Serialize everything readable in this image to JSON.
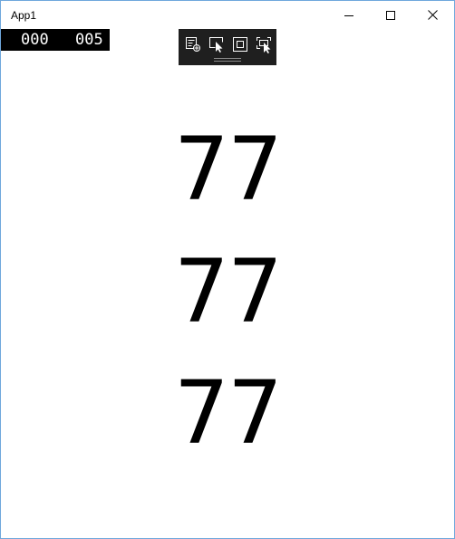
{
  "window": {
    "title": "App1"
  },
  "frame_counter": {
    "value_1": "000",
    "value_2": "005"
  },
  "content": {
    "numbers": [
      "77",
      "77",
      "77"
    ]
  },
  "icons": {
    "minimize": "minimize-icon",
    "maximize": "maximize-icon",
    "close": "close-icon",
    "live_visual_tree": "live-visual-tree-icon",
    "select_element": "select-element-icon",
    "display_layout_adorners": "layout-adorners-icon",
    "track_focused_element": "track-focus-icon"
  },
  "colors": {
    "window_border": "#6fa7dc",
    "toolbar_bg": "#1f1f1f",
    "counter_bg": "#000000"
  }
}
